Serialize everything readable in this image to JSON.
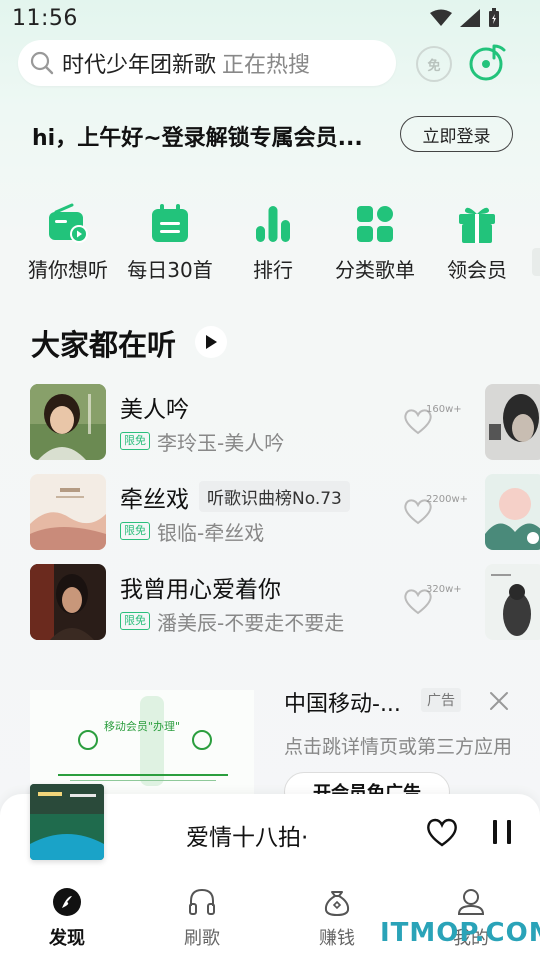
{
  "status_bar": {
    "time": "11:56"
  },
  "search": {
    "query": "时代少年团新歌",
    "hint": "正在热搜"
  },
  "header": {
    "free_icon_label": "免"
  },
  "greeting": {
    "text": "hi，上午好~登录解锁专属会员...",
    "login_label": "立即登录"
  },
  "quick_nav": [
    {
      "label": "猜你想听",
      "icon": "radio-icon"
    },
    {
      "label": "每日30首",
      "icon": "calendar-icon"
    },
    {
      "label": "排行",
      "icon": "chart-bars-icon"
    },
    {
      "label": "分类歌单",
      "icon": "grid-icon"
    },
    {
      "label": "领会员",
      "icon": "gift-icon"
    }
  ],
  "section": {
    "title": "大家都在听"
  },
  "songs": [
    {
      "title": "美人吟",
      "tag": "",
      "free": "限免",
      "artist": "李玲玉-美人吟",
      "likes": "160w+"
    },
    {
      "title": "牵丝戏",
      "tag": "听歌识曲榜No.73",
      "free": "限免",
      "artist": "银临-牵丝戏",
      "likes": "2200w+"
    },
    {
      "title": "我曾用心爱着你",
      "tag": "",
      "free": "限免",
      "artist": "潘美辰-不要走不要走",
      "likes": "320w+"
    }
  ],
  "ad": {
    "title": "中国移动-...",
    "tag": "广告",
    "description": "点击跳详情页或第三方应用",
    "button": "开会员免广告",
    "image_text": "移动会员\"办理\""
  },
  "player": {
    "title": "爱情十八拍·"
  },
  "tabs": [
    {
      "label": "发现",
      "icon": "discover-icon",
      "active": true
    },
    {
      "label": "刷歌",
      "icon": "headphones-icon",
      "active": false
    },
    {
      "label": "赚钱",
      "icon": "money-bag-icon",
      "active": false
    },
    {
      "label": "我的",
      "icon": "user-icon",
      "active": false
    }
  ],
  "watermark": "ITMOP.COM",
  "colors": {
    "accent": "#22c37b",
    "text": "#111111",
    "muted": "#888888"
  }
}
